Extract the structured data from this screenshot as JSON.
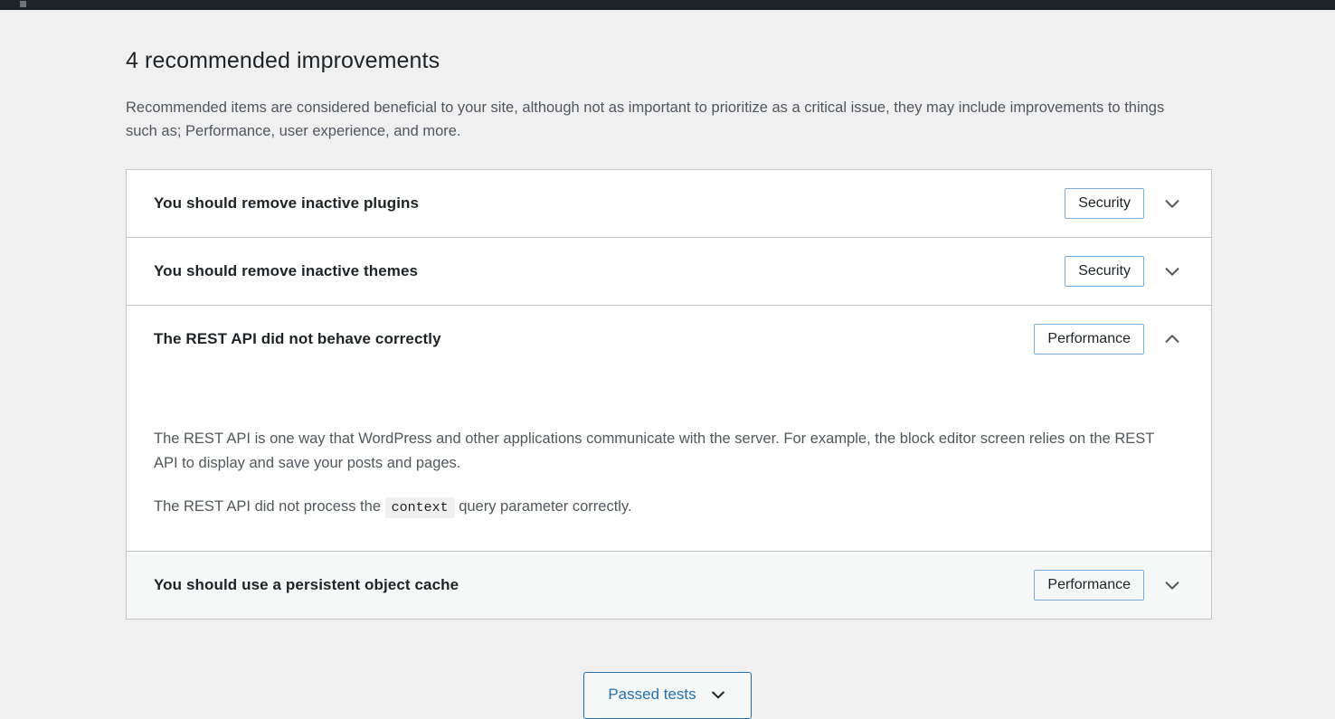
{
  "admin_bar": {
    "icon": "wordpress-logo-icon"
  },
  "section": {
    "title": "4 recommended improvements",
    "description": "Recommended items are considered beneficial to your site, although not as important to prioritize as a critical issue, they may include improvements to things such as; Performance, user experience, and more."
  },
  "accordion": {
    "items": [
      {
        "title": "You should remove inactive plugins",
        "badge": "Security",
        "expanded": false,
        "chevron_icon": "chevron-down-icon"
      },
      {
        "title": "You should remove inactive themes",
        "badge": "Security",
        "expanded": false,
        "chevron_icon": "chevron-down-icon"
      },
      {
        "title": "The REST API did not behave correctly",
        "badge": "Performance",
        "expanded": true,
        "chevron_icon": "chevron-up-icon",
        "body": {
          "paragraph_1": "The REST API is one way that WordPress and other applications communicate with the server. For example, the block editor screen relies on the REST API to display and save your posts and pages.",
          "paragraph_2_before": "The REST API did not process the",
          "paragraph_2_code": "context",
          "paragraph_2_after": "query parameter correctly."
        }
      },
      {
        "title": "You should use a persistent object cache",
        "badge": "Performance",
        "expanded": false,
        "chevron_icon": "chevron-down-icon"
      }
    ]
  },
  "footer": {
    "passed_tests_label": "Passed tests",
    "passed_tests_icon": "chevron-down-icon"
  },
  "colors": {
    "page_background": "#f0f0f1",
    "panel_background": "#ffffff",
    "admin_bar": "#1d2327",
    "border": "#c3c4c7",
    "badge_border": "#72aee6",
    "accent_blue": "#2271b1",
    "heading_text": "#1d2327",
    "body_text": "#50575e",
    "shaded_row": "#f6f7f7",
    "code_background": "#f0f0f1"
  }
}
